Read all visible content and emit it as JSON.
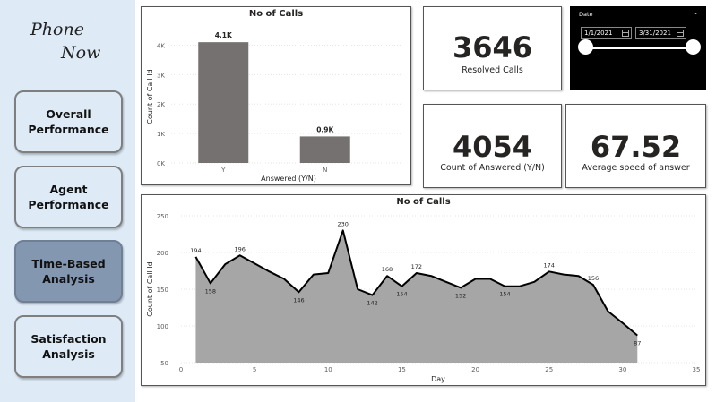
{
  "app": {
    "logo_line1": "Phone",
    "logo_line2": "Now"
  },
  "nav": {
    "items": [
      {
        "label": "Overall\nPerformance",
        "active": false
      },
      {
        "label": "Agent\nPerformance",
        "active": false
      },
      {
        "label": "Time-Based\nAnalysis",
        "active": true
      },
      {
        "label": "Satisfaction\nAnalysis",
        "active": false
      }
    ]
  },
  "kpis": {
    "resolved": {
      "value": "3646",
      "label": "Resolved Calls"
    },
    "answered": {
      "value": "4054",
      "label": "Count of Answered (Y/N)"
    },
    "speed": {
      "value": "67.52",
      "label": "Average speed of answer"
    }
  },
  "slicer": {
    "title": "Date",
    "start": "1/1/2021",
    "end": "3/31/2021",
    "range_fraction": [
      0,
      1
    ]
  },
  "colors": {
    "sidebar_bg": "#deebf7",
    "active_nav": "#8497b0",
    "bar": "#767171",
    "area": "#a6a6a6",
    "line": "#000000"
  },
  "chart_data": [
    {
      "type": "bar",
      "title": "No of Calls",
      "xlabel": "Answered (Y/N)",
      "ylabel": "Count of Call Id",
      "categories": [
        "Y",
        "N"
      ],
      "values": [
        4100,
        900
      ],
      "data_labels": [
        "4.1K",
        "0.9K"
      ],
      "yticks": [
        "0K",
        "1K",
        "2K",
        "3K",
        "4K"
      ],
      "ylim": [
        0,
        4500
      ],
      "grid": true,
      "legend": "none"
    },
    {
      "type": "area",
      "title": "No of Calls",
      "xlabel": "Day",
      "ylabel": "Count of Call Id",
      "xticks": [
        "0",
        "5",
        "10",
        "15",
        "20",
        "25",
        "30",
        "35"
      ],
      "yticks": [
        "50",
        "100",
        "150",
        "200",
        "250"
      ],
      "xlim": [
        0,
        35
      ],
      "ylim": [
        50,
        250
      ],
      "grid": true,
      "legend": "none",
      "x": [
        1,
        2,
        3,
        4,
        5,
        6,
        7,
        8,
        9,
        10,
        11,
        12,
        13,
        14,
        15,
        16,
        17,
        18,
        19,
        20,
        21,
        22,
        23,
        24,
        25,
        26,
        27,
        28,
        29,
        30,
        31
      ],
      "values": [
        194,
        158,
        184,
        196,
        185,
        174,
        164,
        146,
        170,
        172,
        230,
        150,
        142,
        168,
        154,
        172,
        168,
        160,
        152,
        164,
        164,
        154,
        154,
        160,
        174,
        170,
        168,
        156,
        120,
        104,
        87
      ],
      "point_labels": [
        {
          "i": 0,
          "text": "194"
        },
        {
          "i": 1,
          "text": "158"
        },
        {
          "i": 3,
          "text": "196"
        },
        {
          "i": 7,
          "text": "146"
        },
        {
          "i": 10,
          "text": "230"
        },
        {
          "i": 12,
          "text": "142"
        },
        {
          "i": 13,
          "text": "168"
        },
        {
          "i": 14,
          "text": "154"
        },
        {
          "i": 15,
          "text": "172"
        },
        {
          "i": 18,
          "text": "152"
        },
        {
          "i": 21,
          "text": "154"
        },
        {
          "i": 24,
          "text": "174"
        },
        {
          "i": 27,
          "text": "156"
        },
        {
          "i": 30,
          "text": "87"
        }
      ]
    }
  ]
}
